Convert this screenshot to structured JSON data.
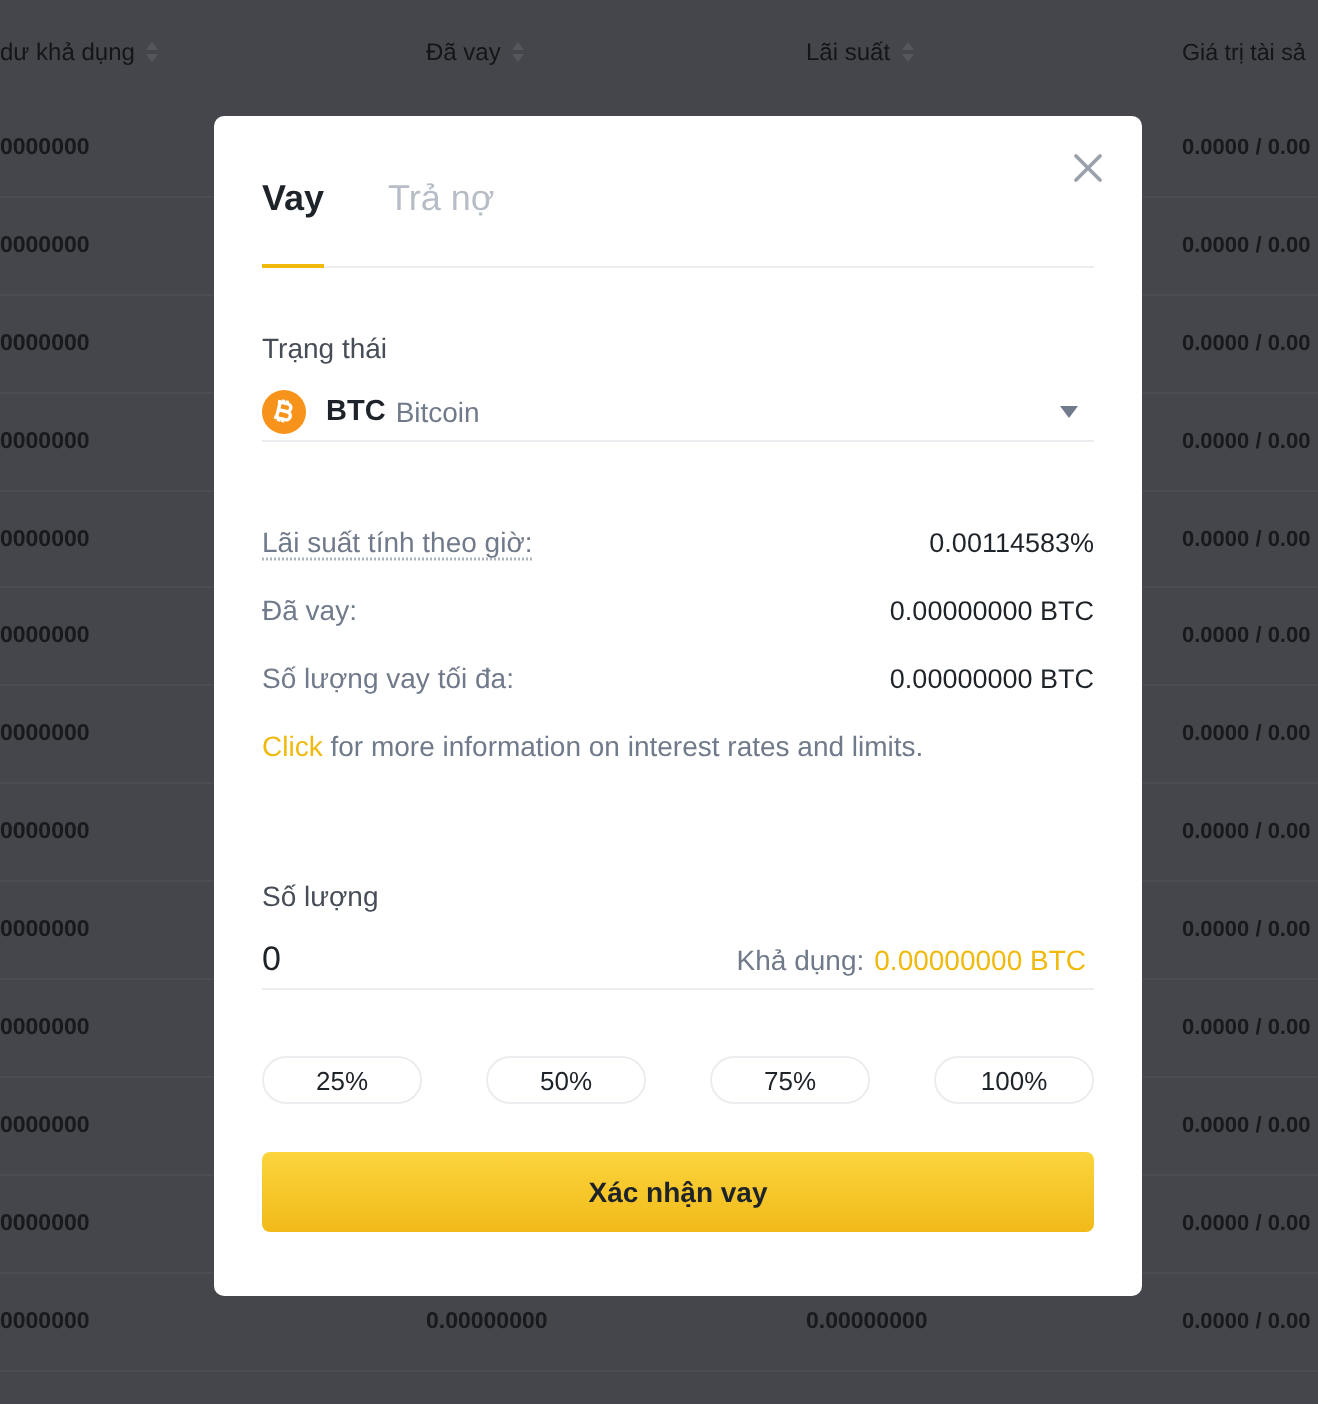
{
  "background_table": {
    "columns": [
      {
        "label": "dư khả dụng",
        "sortable": true
      },
      {
        "label": "Đã vay",
        "sortable": true
      },
      {
        "label": "Lãi suất",
        "sortable": true
      },
      {
        "label": "Giá trị tài sả",
        "sortable": false
      }
    ],
    "rows": [
      {
        "available": "0000000",
        "asset_value": "0.0000 / 0.00"
      },
      {
        "available": "0000000",
        "asset_value": "0.0000 / 0.00"
      },
      {
        "available": "0000000",
        "asset_value": "0.0000 / 0.00"
      },
      {
        "available": "0000000",
        "asset_value": "0.0000 / 0.00"
      },
      {
        "available": "0000000",
        "asset_value": "0.0000 / 0.00"
      },
      {
        "available": "0000000",
        "asset_value": "0.0000 / 0.00"
      },
      {
        "available": "0000000",
        "asset_value": "0.0000 / 0.00"
      },
      {
        "available": "0000000",
        "asset_value": "0.0000 / 0.00"
      },
      {
        "available": "0000000",
        "asset_value": "0.0000 / 0.00"
      },
      {
        "available": "0000000",
        "asset_value": "0.0000 / 0.00"
      },
      {
        "available": "0000000",
        "asset_value": "0.0000 / 0.00"
      },
      {
        "available": "0000000",
        "asset_value": "0.0000 / 0.00"
      },
      {
        "available": "0000000",
        "borrowed": "0.00000000",
        "interest": "0.00000000",
        "asset_value": "0.0000 / 0.00"
      }
    ]
  },
  "dialog": {
    "tabs": [
      {
        "label": "Vay",
        "selected": true
      },
      {
        "label": "Trả nợ",
        "selected": false
      }
    ],
    "coin_label": "Trạng thái",
    "coin": {
      "symbol": "BTC",
      "name": "Bitcoin"
    },
    "details": [
      {
        "label": "Lãi suất tính theo giờ:",
        "value": "0.00114583%",
        "underlined": true
      },
      {
        "label": "Đã vay:",
        "value": "0.00000000 BTC",
        "underlined": false
      },
      {
        "label": "Số lượng vay tối đa:",
        "value": "0.00000000 BTC",
        "underlined": false
      }
    ],
    "note": {
      "link": "Click",
      "text": "for more information on interest rates and limits."
    },
    "amount": {
      "label": "Số lượng",
      "value": "0",
      "available_label": "Khả dụng:",
      "available_value": "0.00000000 BTC"
    },
    "percent_buttons": [
      {
        "label": "25%"
      },
      {
        "label": "50%"
      },
      {
        "label": "75%"
      },
      {
        "label": "100%"
      }
    ],
    "confirm_button": "Xác nhận vay"
  }
}
